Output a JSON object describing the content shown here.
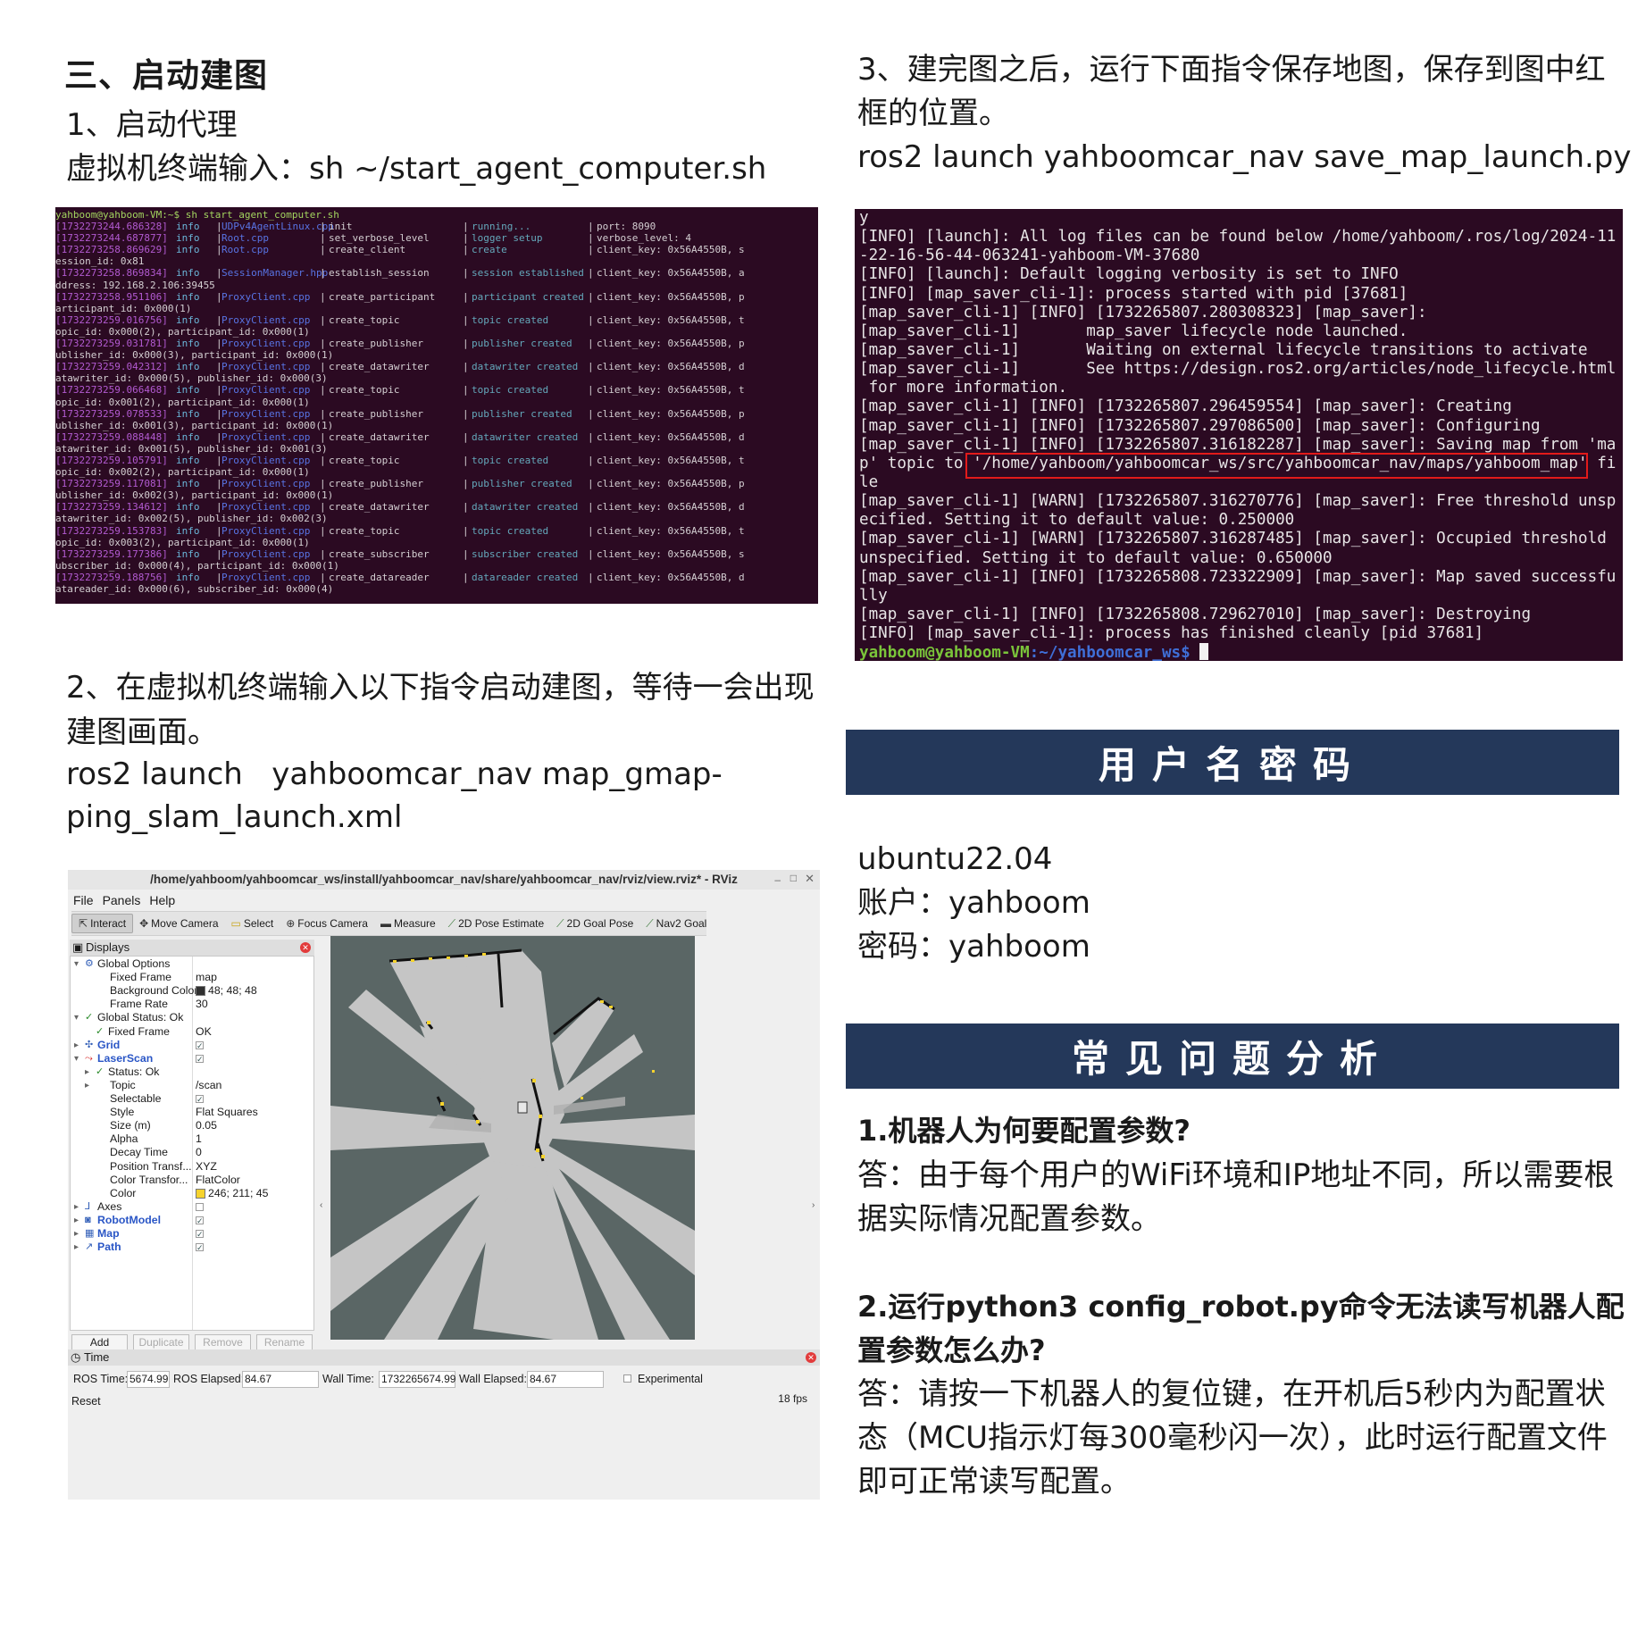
{
  "left": {
    "section_title": "三、启动建图",
    "step1_title": "1、启动代理",
    "step1_cmd": "虚拟机终端输入：sh ~/start_agent_computer.sh",
    "step2_line1": "2、在虚拟机终端输入以下指令启动建图，等待一会出现",
    "step2_line2": "建图画面。",
    "step2_cmd_line1": "ros2 launch   yahboomcar_nav map_gmap-",
    "step2_cmd_line2": "ping_slam_launch.xml"
  },
  "terminal1": {
    "prompt": "yahboom@yahboom-VM:~$ sh start_agent_computer.sh",
    "rows": [
      {
        "ts": "[1732273244.686328]",
        "lvl": "info",
        "file": "UDPv4AgentLinux.cpp",
        "op": "init",
        "stat": "running...",
        "info": "port: 8090"
      },
      {
        "ts": "[1732273244.687877]",
        "lvl": "info",
        "file": "Root.cpp",
        "op": "set_verbose_level",
        "stat": "logger setup",
        "info": "verbose_level: 4"
      },
      {
        "ts": "[1732273258.869629]",
        "lvl": "info",
        "file": "Root.cpp",
        "op": "create_client",
        "stat": "create",
        "info": "client_key: 0x56A4550B, s"
      },
      {
        "cont": "ession_id: 0x81"
      },
      {
        "ts": "[1732273258.869834]",
        "lvl": "info",
        "file": "SessionManager.hpp",
        "op": "establish_session",
        "stat": "session established",
        "info": "client_key: 0x56A4550B, a"
      },
      {
        "cont": "ddress: 192.168.2.106:39455"
      },
      {
        "ts": "[1732273258.951106]",
        "lvl": "info",
        "file": "ProxyClient.cpp",
        "op": "create_participant",
        "stat": "participant created",
        "info": "client_key: 0x56A4550B, p"
      },
      {
        "cont": "articipant_id: 0x000(1)"
      },
      {
        "ts": "[1732273259.016756]",
        "lvl": "info",
        "file": "ProxyClient.cpp",
        "op": "create_topic",
        "stat": "topic created",
        "info": "client_key: 0x56A4550B, t"
      },
      {
        "cont": "opic_id: 0x000(2), participant_id: 0x000(1)"
      },
      {
        "ts": "[1732273259.031781]",
        "lvl": "info",
        "file": "ProxyClient.cpp",
        "op": "create_publisher",
        "stat": "publisher created",
        "info": "client_key: 0x56A4550B, p"
      },
      {
        "cont": "ublisher_id: 0x000(3), participant_id: 0x000(1)"
      },
      {
        "ts": "[1732273259.042312]",
        "lvl": "info",
        "file": "ProxyClient.cpp",
        "op": "create_datawriter",
        "stat": "datawriter created",
        "info": "client_key: 0x56A4550B, d"
      },
      {
        "cont": "atawriter_id: 0x000(5), publisher_id: 0x000(3)"
      },
      {
        "ts": "[1732273259.066468]",
        "lvl": "info",
        "file": "ProxyClient.cpp",
        "op": "create_topic",
        "stat": "topic created",
        "info": "client_key: 0x56A4550B, t"
      },
      {
        "cont": "opic_id: 0x001(2), participant_id: 0x000(1)"
      },
      {
        "ts": "[1732273259.078533]",
        "lvl": "info",
        "file": "ProxyClient.cpp",
        "op": "create_publisher",
        "stat": "publisher created",
        "info": "client_key: 0x56A4550B, p"
      },
      {
        "cont": "ublisher_id: 0x001(3), participant_id: 0x000(1)"
      },
      {
        "ts": "[1732273259.088448]",
        "lvl": "info",
        "file": "ProxyClient.cpp",
        "op": "create_datawriter",
        "stat": "datawriter created",
        "info": "client_key: 0x56A4550B, d"
      },
      {
        "cont": "atawriter_id: 0x001(5), publisher_id: 0x001(3)"
      },
      {
        "ts": "[1732273259.105791]",
        "lvl": "info",
        "file": "ProxyClient.cpp",
        "op": "create_topic",
        "stat": "topic created",
        "info": "client_key: 0x56A4550B, t"
      },
      {
        "cont": "opic_id: 0x002(2), participant_id: 0x000(1)"
      },
      {
        "ts": "[1732273259.117081]",
        "lvl": "info",
        "file": "ProxyClient.cpp",
        "op": "create_publisher",
        "stat": "publisher created",
        "info": "client_key: 0x56A4550B, p"
      },
      {
        "cont": "ublisher_id: 0x002(3), participant_id: 0x000(1)"
      },
      {
        "ts": "[1732273259.134612]",
        "lvl": "info",
        "file": "ProxyClient.cpp",
        "op": "create_datawriter",
        "stat": "datawriter created",
        "info": "client_key: 0x56A4550B, d"
      },
      {
        "cont": "atawriter_id: 0x002(5), publisher_id: 0x002(3)"
      },
      {
        "ts": "[1732273259.153783]",
        "lvl": "info",
        "file": "ProxyClient.cpp",
        "op": "create_topic",
        "stat": "topic created",
        "info": "client_key: 0x56A4550B, t"
      },
      {
        "cont": "opic_id: 0x003(2), participant_id: 0x000(1)"
      },
      {
        "ts": "[1732273259.177386]",
        "lvl": "info",
        "file": "ProxyClient.cpp",
        "op": "create_subscriber",
        "stat": "subscriber created",
        "info": "client_key: 0x56A4550B, s"
      },
      {
        "cont": "ubscriber_id: 0x000(4), participant_id: 0x000(1)"
      },
      {
        "ts": "[1732273259.188756]",
        "lvl": "info",
        "file": "ProxyClient.cpp",
        "op": "create_datareader",
        "stat": "datareader created",
        "info": "client_key: 0x56A4550B, d"
      },
      {
        "cont": "atareader_id: 0x000(6), subscriber_id: 0x000(4)"
      }
    ]
  },
  "rviz": {
    "title": "/home/yahboom/yahboomcar_ws/install/yahboomcar_nav/share/yahboomcar_nav/rviz/view.rviz* - RViz",
    "menu": [
      "File",
      "Panels",
      "Help"
    ],
    "tools": [
      "Interact",
      "Move Camera",
      "Select",
      "Focus Camera",
      "Measure",
      "2D Pose Estimate",
      "2D Goal Pose",
      "Nav2 Goal"
    ],
    "displays_label": "Displays",
    "tree": [
      {
        "k": "Global Options",
        "v": "",
        "lvl": 1,
        "ar": "▾",
        "icon": "⚙"
      },
      {
        "k": "Fixed Frame",
        "v": "map",
        "lvl": 2
      },
      {
        "k": "Background Color",
        "v": "48; 48; 48",
        "lvl": 2,
        "swatch": "#303030"
      },
      {
        "k": "Frame Rate",
        "v": "30",
        "lvl": 2
      },
      {
        "k": "Global Status: Ok",
        "v": "",
        "lvl": 1,
        "ar": "▾",
        "icon": "✓"
      },
      {
        "k": "Fixed Frame",
        "v": "OK",
        "lvl": 2,
        "icon": "✓"
      },
      {
        "k": "Grid",
        "v": "",
        "lvl": 1,
        "ar": "▸",
        "icon": "✣",
        "blue": true,
        "check": true
      },
      {
        "k": "LaserScan",
        "v": "",
        "lvl": 1,
        "ar": "▾",
        "icon": "⤳",
        "blue": true,
        "check": true
      },
      {
        "k": "Status: Ok",
        "v": "",
        "lvl": 2,
        "ar": "▸",
        "icon": "✓"
      },
      {
        "k": "Topic",
        "v": "/scan",
        "lvl": 2,
        "ar": "▸"
      },
      {
        "k": "Selectable",
        "v": "",
        "lvl": 2,
        "check": true
      },
      {
        "k": "Style",
        "v": "Flat Squares",
        "lvl": 2
      },
      {
        "k": "Size (m)",
        "v": "0.05",
        "lvl": 2
      },
      {
        "k": "Alpha",
        "v": "1",
        "lvl": 2
      },
      {
        "k": "Decay Time",
        "v": "0",
        "lvl": 2
      },
      {
        "k": "Position Transf...",
        "v": "XYZ",
        "lvl": 2
      },
      {
        "k": "Color Transfor...",
        "v": "FlatColor",
        "lvl": 2
      },
      {
        "k": "Color",
        "v": "246; 211; 45",
        "lvl": 2,
        "swatch": "#f6d32d"
      },
      {
        "k": "Axes",
        "v": "",
        "lvl": 1,
        "ar": "▸",
        "icon": "⅃",
        "uncheck": true
      },
      {
        "k": "RobotModel",
        "v": "",
        "lvl": 1,
        "ar": "▸",
        "icon": "◙",
        "blue": true,
        "check": true
      },
      {
        "k": "Map",
        "v": "",
        "lvl": 1,
        "ar": "▸",
        "icon": "▦",
        "blue": true,
        "check": true
      },
      {
        "k": "Path",
        "v": "",
        "lvl": 1,
        "ar": "▸",
        "icon": "↗",
        "blue": true,
        "check": true
      }
    ],
    "buttons": [
      "Add",
      "Duplicate",
      "Remove",
      "Rename"
    ],
    "time_label": "Time",
    "ros_time_label": "ROS Time:",
    "ros_time": "5674.99",
    "ros_elapsed_label": "ROS Elapsed:",
    "ros_elapsed": "84.67",
    "wall_time_label": "Wall Time:",
    "wall_time": "1732265674.99",
    "wall_elapsed_label": "Wall Elapsed:",
    "wall_elapsed": "84.67",
    "experimental": "Experimental",
    "reset": "Reset",
    "fps": "18 fps"
  },
  "right": {
    "step3_line1": "3、建完图之后，运行下面指令保存地图，保存到图中红",
    "step3_line2": "框的位置。",
    "step3_cmd": "ros2 launch yahboomcar_nav save_map_launch.py",
    "banner_account": "用户名密码",
    "os": "ubuntu22.04",
    "account": "账户：yahboom",
    "password": "密码：yahboom",
    "banner_faq": "常见问题分析",
    "q1": "1.机器人为何要配置参数?",
    "a1_line1": "答：由于每个用户的WiFi环境和IP地址不同，所以需要根",
    "a1_line2": "据实际情况配置参数。",
    "q2_line1": "2.运行python3 config_robot.py命令无法读写机器人配",
    "q2_line2": "置参数怎么办?",
    "a2_line1": "答：请按一下机器人的复位键，在开机后5秒内为配置状",
    "a2_line2": "态（MCU指示灯每300毫秒闪一次），此时运行配置文件",
    "a2_line3": "即可正常读写配置。"
  },
  "terminal2": {
    "rows": [
      "y",
      "[INFO] [launch]: All log files can be found below /home/yahboom/.ros/log/2024-11",
      "-22-16-56-44-063241-yahboom-VM-37680",
      "[INFO] [launch]: Default logging verbosity is set to INFO",
      "[INFO] [map_saver_cli-1]: process started with pid [37681]",
      "[map_saver_cli-1] [INFO] [1732265807.280308323] [map_saver]:",
      "[map_saver_cli-1]       map_saver lifecycle node launched.",
      "[map_saver_cli-1]       Waiting on external lifecycle transitions to activate",
      "[map_saver_cli-1]       See https://design.ros2.org/articles/node_lifecycle.html",
      " for more information.",
      "[map_saver_cli-1] [INFO] [1732265807.296459554] [map_saver]: Creating",
      "[map_saver_cli-1] [INFO] [1732265807.297086500] [map_saver]: Configuring",
      "[map_saver_cli-1] [INFO] [1732265807.316182287] [map_saver]: Saving map from 'ma",
      "p' topic to '/home/yahboom/yahboomcar_ws/src/yahboomcar_nav/maps/yahboom_map' fi",
      "le",
      "[map_saver_cli-1] [WARN] [1732265807.316270776] [map_saver]: Free threshold unsp",
      "ecified. Setting it to default value: 0.250000",
      "[map_saver_cli-1] [WARN] [1732265807.316287485] [map_saver]: Occupied threshold",
      "unspecified. Setting it to default value: 0.650000",
      "[map_saver_cli-1] [INFO] [1732265808.723322909] [map_saver]: Map saved successfu",
      "lly",
      "[map_saver_cli-1] [INFO] [1732265808.729627010] [map_saver]: Destroying",
      "[INFO] [map_saver_cli-1]: process has finished cleanly [pid 37681]"
    ],
    "prompt_user": "yahboom@yahboom-VM",
    "prompt_path": ":~/yahboomcar_ws$ "
  }
}
